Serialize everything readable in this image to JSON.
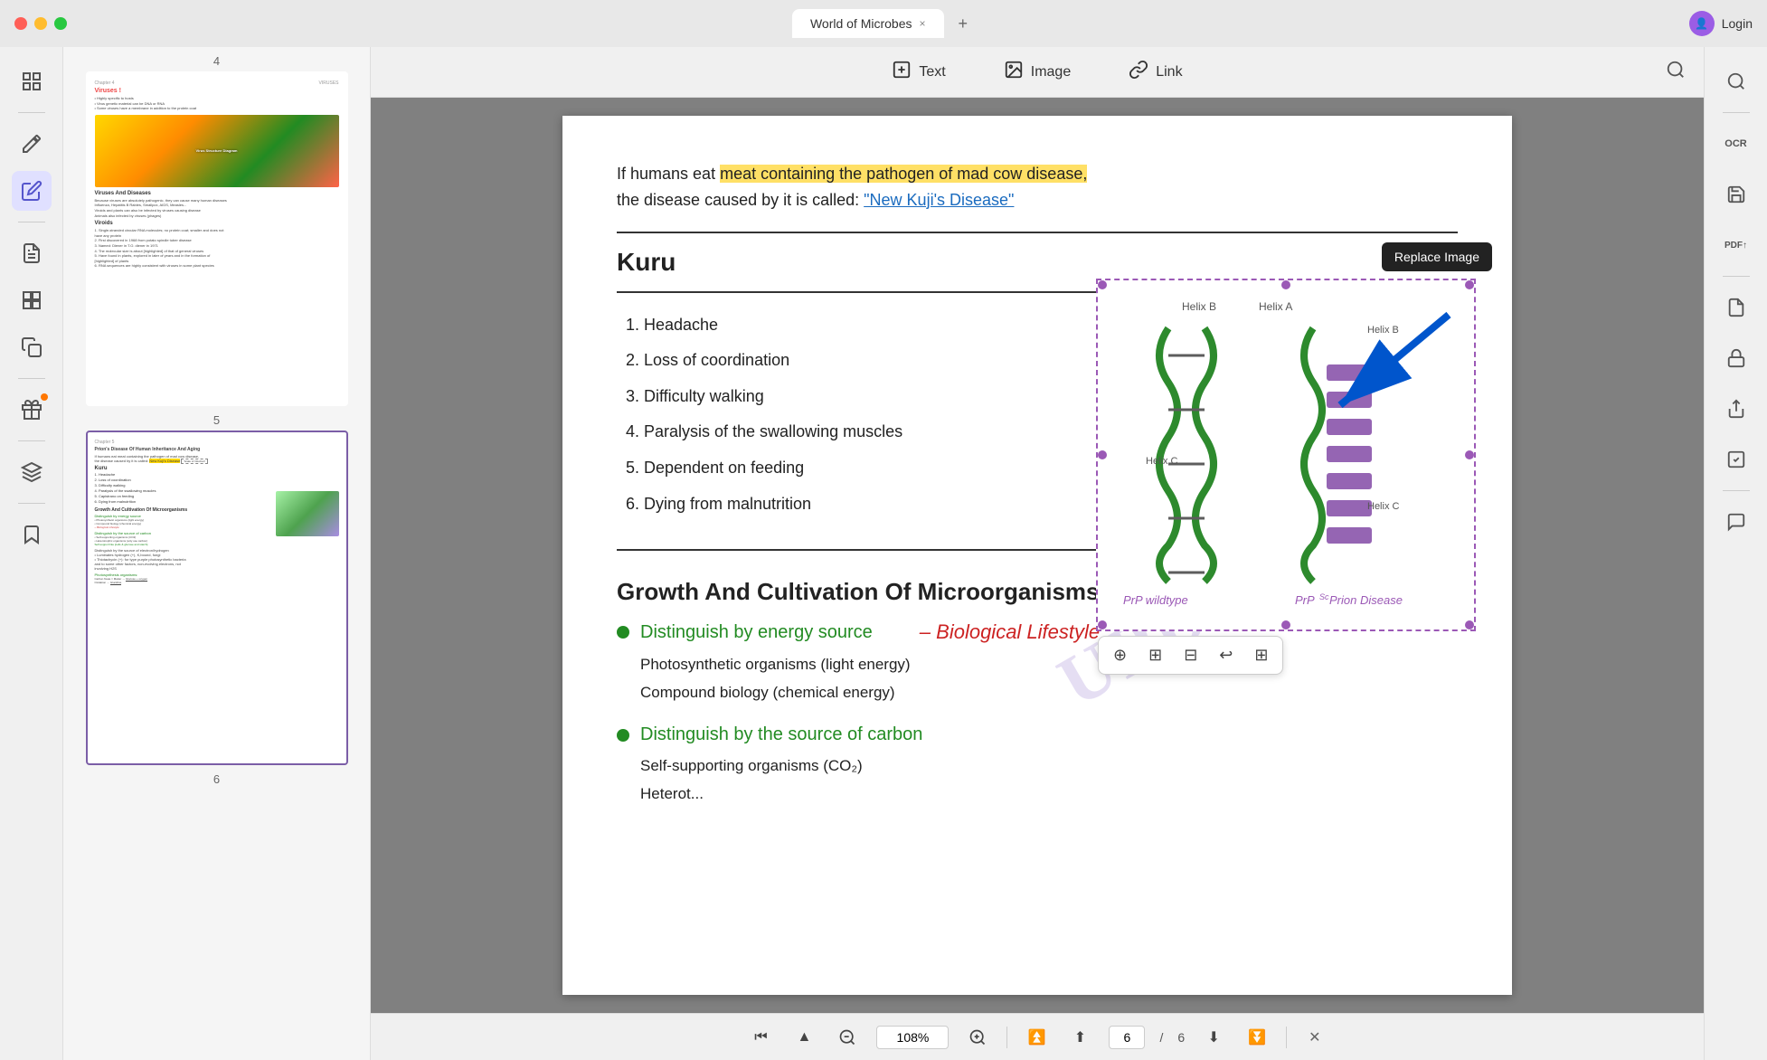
{
  "titlebar": {
    "title": "World of Microbes",
    "tab_close": "×",
    "tab_add": "+",
    "user_label": "Login"
  },
  "toolbar": {
    "text_label": "Text",
    "image_label": "Image",
    "link_label": "Link"
  },
  "thumbnails": {
    "page4_num": "4",
    "page5_num": "5",
    "page6_num": "6"
  },
  "document": {
    "paragraph": "If humans eat meat containing the pathogen of mad cow disease, the disease caused by it is called: \"New Kuji's Disease\"",
    "kuru_title": "Kuru",
    "kuru_items": [
      "Headache",
      "Loss of coordination",
      "Difficulty walking",
      "Paralysis of the swallowing muscles",
      "Dependent on feeding",
      "Dying from malnutrition"
    ],
    "growth_title": "Growth And Cultivation Of Microorganisms",
    "energy_section": {
      "title": "Distinguish by energy source",
      "items": [
        "Photosynthetic organisms (light energy)",
        "Compound biology (chemical energy)"
      ]
    },
    "carbon_section": {
      "title": "Distinguish by the source of carbon",
      "items": [
        "Self-supporting organisms (CO₂)",
        "Heterot..."
      ]
    },
    "bio_lifestyle": "– Biological Lifestyle",
    "watermark": "UPDF",
    "replace_image": "Replace Image",
    "dna_labels": {
      "helix_a": "Helix A",
      "helix_b1": "Helix B",
      "helix_b2": "Helix B",
      "helix_c1": "Helix C",
      "helix_c2": "Helix C",
      "prp_wildtype": "PrP wildtype",
      "prp_disease": "PrPˢᶜ Prion Disease"
    }
  },
  "bottombar": {
    "zoom": "108%",
    "page_current": "6",
    "page_total": "6"
  },
  "sidebar_icons": {
    "list_icon": "☰",
    "edit_icon": "✏️",
    "text_icon": "📄",
    "copy_icon": "⊞",
    "layers_icon": "⊟",
    "bookmark_icon": "🔖"
  },
  "right_icons": {
    "search_icon": "🔍",
    "ocr_icon": "OCR",
    "save_icon": "💾",
    "pdf_icon": "PDF↑",
    "save2_icon": "📄",
    "lock_icon": "🔒",
    "share_icon": "↑",
    "check_icon": "✓",
    "chat_icon": "💬"
  }
}
